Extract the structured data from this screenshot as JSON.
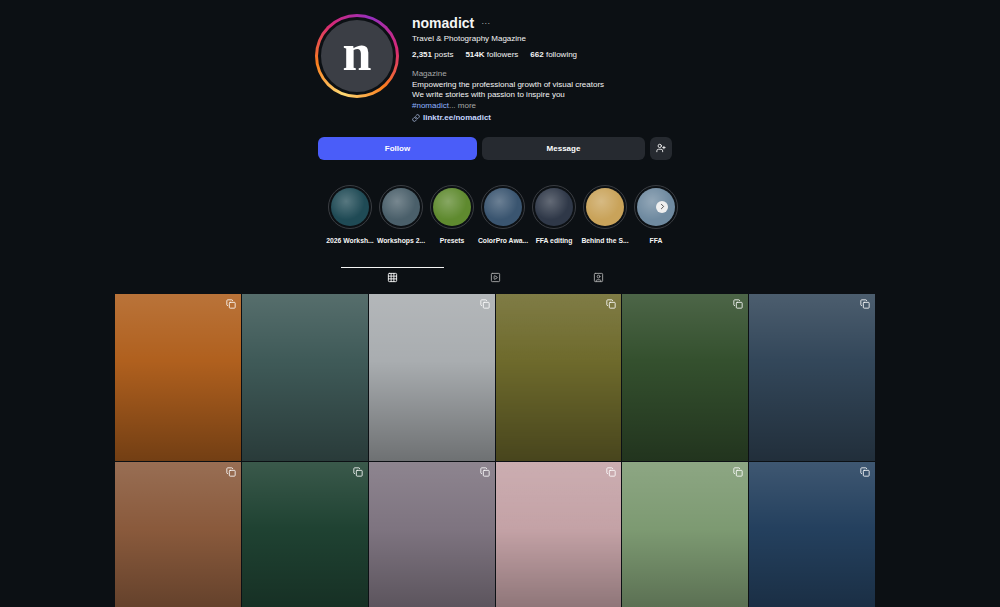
{
  "profile": {
    "logo_letter": "n",
    "username": "nomadict",
    "more": "···",
    "tagline": "Travel & Photography Magazine",
    "stats": [
      {
        "value": "2,351",
        "label": "posts"
      },
      {
        "value": "514K",
        "label": "followers"
      },
      {
        "value": "662",
        "label": "following"
      }
    ],
    "category": "Magazine",
    "bio": [
      "Empowering the professional growth of visual creators",
      "We write stories with passion to inspire you"
    ],
    "hashtag": "#nomadict",
    "more_link": "... more",
    "link": "linktr.ee/nomadict"
  },
  "buttons": {
    "follow": "Follow",
    "message": "Message"
  },
  "highlights": [
    {
      "label": "2026 Worksh...",
      "color": "#1f4a55"
    },
    {
      "label": "Workshops 2...",
      "color": "#4a5f6a"
    },
    {
      "label": "Presets",
      "color": "#5f8a2f"
    },
    {
      "label": "ColorPro Awa...",
      "color": "#3a5570"
    },
    {
      "label": "FFA editing",
      "color": "#2f3848"
    },
    {
      "label": "Behind the S...",
      "color": "#c9a35a"
    },
    {
      "label": "FFA",
      "color": "#6f8aa0"
    }
  ],
  "tabs": [
    {
      "name": "posts",
      "selected": true
    },
    {
      "name": "reels",
      "selected": false
    },
    {
      "name": "tagged",
      "selected": false
    }
  ],
  "posts": [
    {
      "color": "#b0601e",
      "carousel": true
    },
    {
      "color": "#3f5a58",
      "carousel": false
    },
    {
      "color": "#a9adb0",
      "carousel": true
    },
    {
      "color": "#6e6a2c",
      "carousel": true
    },
    {
      "color": "#34502e",
      "carousel": true
    },
    {
      "color": "#33475a",
      "carousel": true
    },
    {
      "color": "#8a5a3c",
      "carousel": true
    },
    {
      "color": "#1f4232",
      "carousel": true
    },
    {
      "color": "#7e7480",
      "carousel": true
    },
    {
      "color": "#c4a2a6",
      "carousel": true
    },
    {
      "color": "#7d9a72",
      "carousel": true
    },
    {
      "color": "#24405e",
      "carousel": true
    }
  ]
}
